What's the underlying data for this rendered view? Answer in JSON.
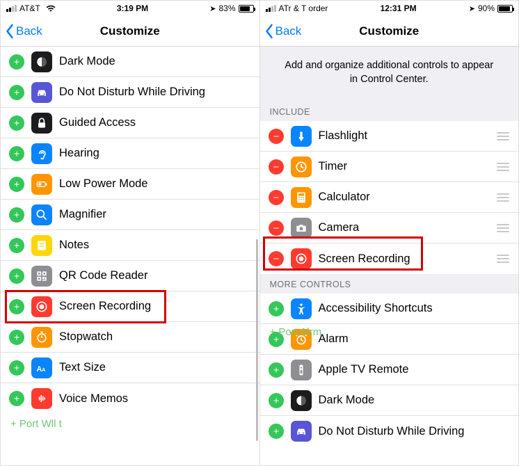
{
  "left": {
    "status": {
      "carrier": "AT&T",
      "time": "3:19 PM",
      "battery_pct": "83%",
      "battery_fill": 83
    },
    "nav": {
      "back": "Back",
      "title": "Customize"
    },
    "items": [
      {
        "label": "Dark Mode",
        "bg": "#1c1c1e",
        "icon": "darkmode"
      },
      {
        "label": "Do Not Disturb While Driving",
        "bg": "#5856d6",
        "icon": "car"
      },
      {
        "label": "Guided Access",
        "bg": "#1c1c1e",
        "icon": "lock"
      },
      {
        "label": "Hearing",
        "bg": "#0a84ff",
        "icon": "ear"
      },
      {
        "label": "Low Power Mode",
        "bg": "#ff9500",
        "icon": "battery"
      },
      {
        "label": "Magnifier",
        "bg": "#0a84ff",
        "icon": "mag"
      },
      {
        "label": "Notes",
        "bg": "#ffd60a",
        "icon": "notes"
      },
      {
        "label": "QR Code Reader",
        "bg": "#8e8e93",
        "icon": "qr"
      },
      {
        "label": "Screen Recording",
        "bg": "#ff3b30",
        "icon": "record"
      },
      {
        "label": "Stopwatch",
        "bg": "#ff9500",
        "icon": "stopwatch"
      },
      {
        "label": "Text Size",
        "bg": "#0a84ff",
        "icon": "textsize"
      },
      {
        "label": "Voice Memos",
        "bg": "#ff3b30",
        "icon": "voice"
      }
    ],
    "watermark": "+ Port Wll t"
  },
  "right": {
    "status": {
      "carrier": "ATr & T order",
      "time": "12:31 PM",
      "battery_pct": "90%",
      "battery_fill": 90
    },
    "nav": {
      "back": "Back",
      "title": "Customize"
    },
    "blurb": "Add and organize additional controls to appear in Control Center.",
    "sect_include": "Include",
    "include": [
      {
        "label": "Flashlight",
        "bg": "#0a84ff",
        "icon": "flash"
      },
      {
        "label": "Timer",
        "bg": "#ff9500",
        "icon": "timer"
      },
      {
        "label": "Calculator",
        "bg": "#ff9500",
        "icon": "calc"
      },
      {
        "label": "Camera",
        "bg": "#8e8e93",
        "icon": "camera"
      },
      {
        "label": "Screen Recording",
        "bg": "#ff3b30",
        "icon": "record"
      }
    ],
    "sect_more": "More Controls",
    "more": [
      {
        "label": "Accessibility Shortcuts",
        "bg": "#0a84ff",
        "icon": "access"
      },
      {
        "label": "Alarm",
        "bg": "#ff9500",
        "icon": "alarm"
      },
      {
        "label": "Apple TV Remote",
        "bg": "#8e8e93",
        "icon": "remote"
      },
      {
        "label": "Dark Mode",
        "bg": "#1c1c1e",
        "icon": "darkmode"
      },
      {
        "label": "Do Not Disturb While Driving",
        "bg": "#5856d6",
        "icon": "car"
      }
    ],
    "watermark": "+ Port Alrm"
  }
}
